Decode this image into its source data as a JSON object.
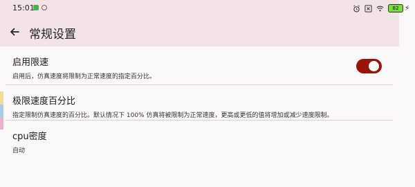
{
  "status_bar": {
    "time": "15:01",
    "battery_level": "82"
  },
  "header": {
    "title": "常规设置"
  },
  "settings": [
    {
      "title": "启用限速",
      "subtitle": "启用后，仿真速度将限制为正常速度的指定百分比。",
      "toggle_on": true
    },
    {
      "title": "极限速度百分比",
      "subtitle": "指定限制仿真速度的百分比。默认情况下 100% 仿真将被限制为正常速度，更高或更低的值将增加或减少速度限制。"
    },
    {
      "title": "cpu密度",
      "subtitle": "自动"
    }
  ],
  "colors": {
    "header_bg": "#f3e3e6",
    "accent": "#9a140c"
  }
}
